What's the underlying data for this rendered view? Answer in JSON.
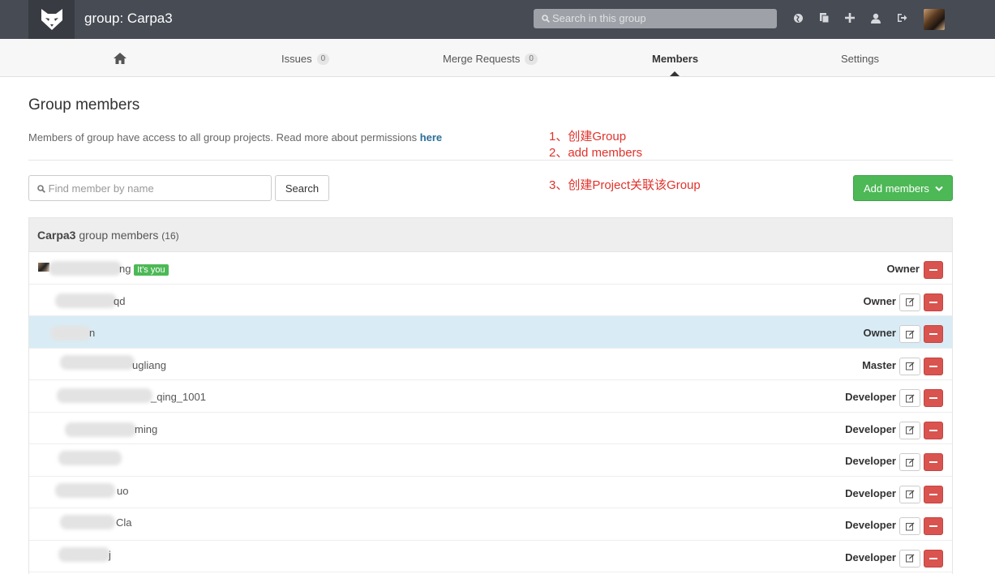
{
  "header": {
    "title": "group: Carpa3",
    "search_placeholder": "Search in this group",
    "icons": [
      "globe-icon",
      "copy-icon",
      "plus-icon",
      "user-icon",
      "sign-out-icon"
    ]
  },
  "nav": {
    "home_icon": "home-icon",
    "issues_label": "Issues",
    "issues_count": "0",
    "mr_label": "Merge Requests",
    "mr_count": "0",
    "members_label": "Members",
    "settings_label": "Settings"
  },
  "page": {
    "title": "Group members",
    "description": "Members of group have access to all group projects. Read more about permissions ",
    "description_link": "here",
    "find_placeholder": "Find member by name",
    "search_button": "Search",
    "add_members_button": "Add members"
  },
  "annotations": [
    "1、创建Group",
    "2、add members",
    "3、创建Project关联该Group"
  ],
  "panel": {
    "group_name": "Carpa3",
    "heading_text": " group members ",
    "count": "(16)"
  },
  "members": [
    {
      "name_visible": "ng",
      "you_badge": "It's you",
      "role": "Owner",
      "editable": false
    },
    {
      "name_visible": "qd",
      "role": "Owner",
      "editable": true
    },
    {
      "name_visible": "n",
      "role": "Owner",
      "editable": true
    },
    {
      "name_visible": "ugliang",
      "role": "Master",
      "editable": true
    },
    {
      "name_visible": "_qing_1001",
      "role": "Developer",
      "editable": true
    },
    {
      "name_visible": "ming",
      "role": "Developer",
      "editable": true
    },
    {
      "name_visible": "",
      "role": "Developer",
      "editable": true
    },
    {
      "name_visible": "uo",
      "role": "Developer",
      "editable": true
    },
    {
      "name_visible": "Cla",
      "role": "Developer",
      "editable": true
    },
    {
      "name_visible": "j",
      "role": "Developer",
      "editable": true
    }
  ],
  "colors": {
    "header_bg": "#464b54",
    "add_button": "#4db856",
    "remove_button": "#d9534f",
    "highlight_row": "#d9ecf5",
    "annotation": "#e0322b",
    "link": "#2b6e98"
  }
}
